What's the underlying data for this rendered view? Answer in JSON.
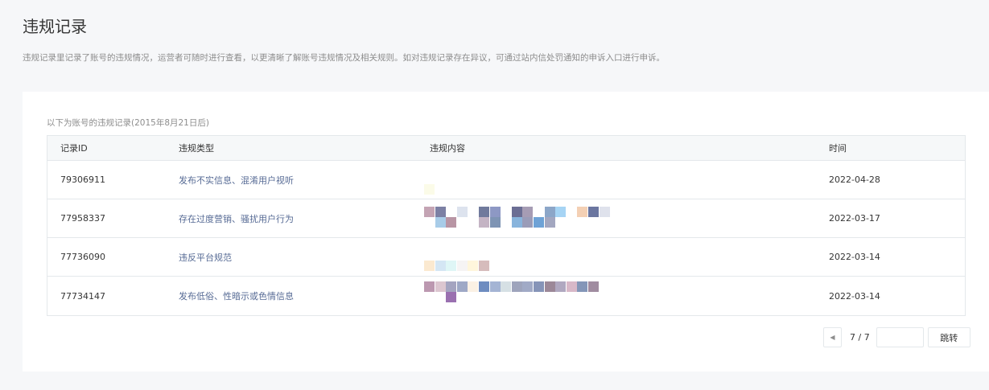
{
  "page": {
    "title": "违规记录",
    "description": "违规记录里记录了账号的违规情况，运营者可随时进行查看，以更清晰了解账号违规情况及相关规则。如对违规记录存在异议，可通过站内信处罚通知的申诉入口进行申诉。"
  },
  "table": {
    "caption": "以下为账号的违规记录(2015年8月21日后)",
    "headers": {
      "id": "记录ID",
      "type": "违规类型",
      "content": "违规内容",
      "time": "时间"
    },
    "rows": [
      {
        "id": "79306911",
        "type": "发布不实信息、混淆用户视听",
        "time": "2022-04-28"
      },
      {
        "id": "77958337",
        "type": "存在过度营销、骚扰用户行为",
        "time": "2022-03-17"
      },
      {
        "id": "77736090",
        "type": "违反平台规范",
        "time": "2022-03-14"
      },
      {
        "id": "77734147",
        "type": "发布低俗、性暗示或色情信息",
        "time": "2022-03-14"
      }
    ]
  },
  "pagination": {
    "prev_icon": "caret-left-icon",
    "page_info": "7 / 7",
    "jump_input_value": "",
    "jump_label": "跳转"
  },
  "colors": {
    "link": "#576b95",
    "background": "#f6f7f9",
    "border": "#e4e8eb"
  }
}
